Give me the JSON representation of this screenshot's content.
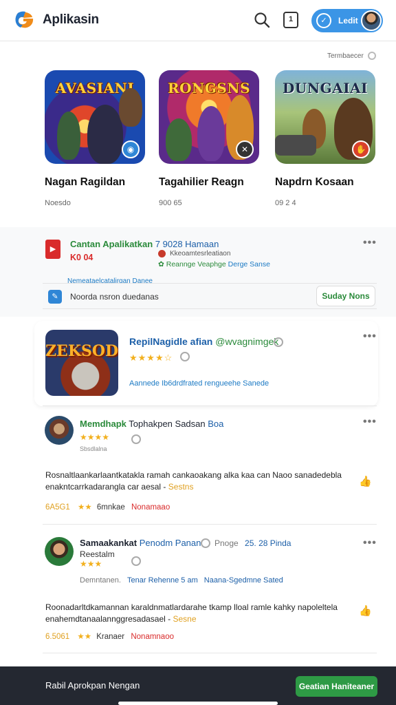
{
  "header": {
    "title": "Aplikasin",
    "notif_count": "1",
    "edit_label": "Ledit"
  },
  "top_meta": "Termbaecer",
  "games": [
    {
      "thumb_text": "AVASIANI",
      "name": "Nagan Ragildan",
      "meta": "Noesdo"
    },
    {
      "thumb_text": "RONGSNS",
      "name": "Tagahilier Reagn",
      "meta": "900 65"
    },
    {
      "thumb_text": "DUNGAIAI",
      "name": "Napdrn Kosaan",
      "meta": "09 2 4"
    }
  ],
  "recommend": {
    "title_green": "Cantan Apalikatkan",
    "title_blue": "7 9028 Hamaan",
    "code": "K0 04",
    "sub1": "Kkeoamtesrleatiaon",
    "sub2_green": "Reannge Veaphge",
    "sub2_blue": "Derge Sanse",
    "link": "Nemeataelcatalirgan Danee",
    "notice_text": "Noorda nsron duedanas",
    "notice_btn": "Suday Nons"
  },
  "feature": {
    "thumb_text": "ZEKSOD",
    "title_blue": "RepilNagidle afian",
    "title_green": "@wvagnimgek",
    "stars": "★★★★☆",
    "desc": "Aannede Ib6drdfrated rengueehe Sanede"
  },
  "reviews": [
    {
      "name_green": "Memdhapk",
      "name_dark": "Tophakpen Sadsan",
      "name_blue": "Boa",
      "stars": "★★★★",
      "stars_meta": "Sbsdlalna",
      "body": "Rosnaltlaankarlaantkatakla ramah cankaoakang alka kaa can Naoo sanadedebla enakntcarrkadarangla car aesal -",
      "tag": "Sestns",
      "foot_orange": "6A5G1",
      "foot_stars": "★★",
      "foot_dark": "6mnkae",
      "foot_red": "Nonamaao"
    },
    {
      "name_dark": "Samaakankat",
      "name_blue": "Penodm Panan",
      "meta_grey": "Pnoge",
      "meta_blue": "25. 28 Pinda",
      "subtitle": "Reestalm",
      "stars": "★★★",
      "sub_line_grey": "Demntanen.",
      "sub_line_blue": "Tenar Rehenne 5 am",
      "sub_line_blue2": "Naana-Sgedmne Sated",
      "body": "Roonadarltdkamannan karaldnmatlardarahe tkamp lloal ramle kahky napoleltela enahemdtanaalannggresadasael -",
      "tag": "Sesne",
      "foot_orange": "6.5061",
      "foot_stars": "★★",
      "foot_dark": "Kranaer",
      "foot_red": "Nonamnaoo"
    }
  ],
  "bottom": {
    "text": "Rabil Aprokpan Nengan",
    "button": "Geatian  Haniteaner"
  }
}
